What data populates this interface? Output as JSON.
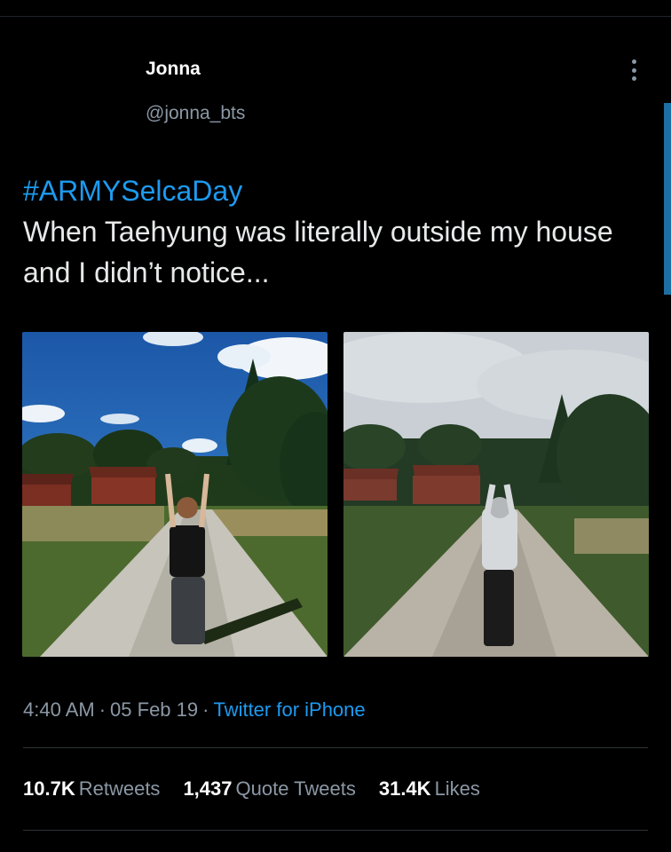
{
  "author": {
    "name": "Jonna",
    "handle": "@jonna_bts"
  },
  "tweet": {
    "hashtag": "#ARMYSelcaDay",
    "text": "When Taehyung was literally outside my house and I didn’t notice..."
  },
  "meta": {
    "time": "4:40 AM",
    "date": "05 Feb 19",
    "separator": "·",
    "source": "Twitter for iPhone"
  },
  "stats": [
    {
      "count": "10.7K",
      "label": "Retweets"
    },
    {
      "count": "1,437",
      "label": "Quote Tweets"
    },
    {
      "count": "31.4K",
      "label": "Likes"
    }
  ],
  "icons": {
    "more": "more-vertical-icon"
  },
  "colors": {
    "background": "#000000",
    "link": "#1d9bf0",
    "secondary": "#8b98a5",
    "primary_text": "#e7e9ea"
  }
}
